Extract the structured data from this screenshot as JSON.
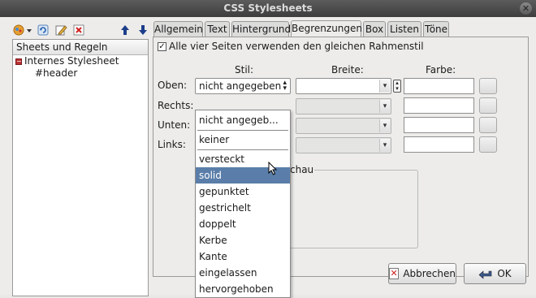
{
  "window": {
    "title": "CSS Stylesheets",
    "close_glyph": "✕"
  },
  "toolbar": {
    "icons": [
      "add-sheet-icon",
      "dropdown-arrow-icon",
      "refresh-icon",
      "edit-icon",
      "delete-icon",
      "move-up-icon",
      "move-down-icon"
    ]
  },
  "tree": {
    "header": "Sheets und Regeln",
    "items": [
      {
        "label": "Internes Stylesheet",
        "toggle": "−"
      },
      {
        "label": "#header"
      }
    ]
  },
  "tabs": [
    "Allgemein",
    "Text",
    "Hintergrund",
    "Begrenzungen",
    "Box",
    "Listen",
    "Töne"
  ],
  "active_tab": "Begrenzungen",
  "borders": {
    "same_style_checkbox": {
      "checked": true,
      "label": "Alle vier Seiten verwenden den gleichen Rahmenstil"
    },
    "columns": {
      "style": "Stil:",
      "width": "Breite:",
      "color": "Farbe:"
    },
    "rows": [
      {
        "label": "Oben:",
        "style_value": "nicht angegeben"
      },
      {
        "label": "Rechts:"
      },
      {
        "label": "Unten:"
      },
      {
        "label": "Links:"
      }
    ],
    "preview_label_fragment": "chau"
  },
  "dropdown": {
    "items": [
      "nicht angegeb...",
      "keiner",
      "versteckt",
      "solid",
      "gepunktet",
      "gestrichelt",
      "doppelt",
      "Kerbe",
      "Kante",
      "eingelassen",
      "hervorgehoben"
    ],
    "selected": "solid"
  },
  "buttons": {
    "cancel": "Abbrechen",
    "ok": "OK"
  },
  "colors": {
    "selection": "#5a7ea9",
    "titlebar": "#4a4a4a"
  }
}
